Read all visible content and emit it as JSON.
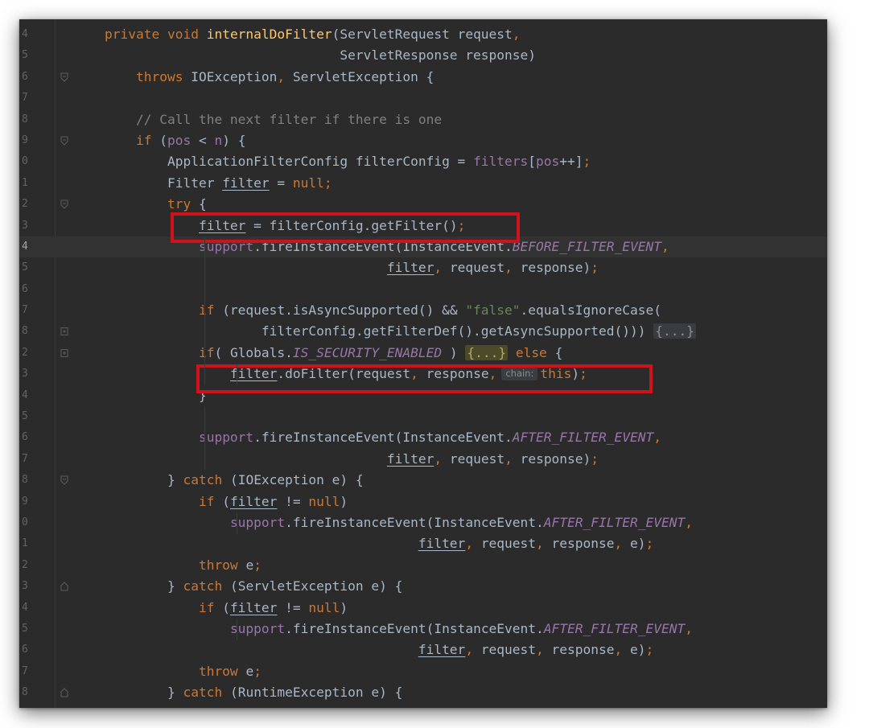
{
  "highlight_color": "#d0131b",
  "editor_theme": "darcula",
  "lines": [
    {
      "ln": "4",
      "indent": 0,
      "fold": "",
      "tokens": [
        {
          "t": "private void ",
          "c": "kw"
        },
        {
          "t": "internalDoFilter",
          "c": "fn"
        },
        {
          "t": "(ServletRequest request",
          "c": "p"
        },
        {
          "t": ",",
          "c": "kw"
        }
      ]
    },
    {
      "ln": "5",
      "indent": 0,
      "fold": "",
      "tokens": [
        {
          "t": "                              ServletResponse response)",
          "c": "p"
        }
      ]
    },
    {
      "ln": "6",
      "indent": 0,
      "fold": "open",
      "tokens": [
        {
          "t": "    throws ",
          "c": "kw"
        },
        {
          "t": "IOException",
          "c": "p"
        },
        {
          "t": ", ",
          "c": "kw"
        },
        {
          "t": "ServletException {",
          "c": "p"
        }
      ]
    },
    {
      "ln": "7",
      "indent": 0,
      "fold": "",
      "tokens": []
    },
    {
      "ln": "8",
      "indent": 0,
      "fold": "",
      "tokens": [
        {
          "t": "    // Call the next filter if there is one",
          "c": "cm"
        }
      ]
    },
    {
      "ln": "9",
      "indent": 0,
      "fold": "open",
      "tokens": [
        {
          "t": "    if ",
          "c": "kw"
        },
        {
          "t": "(",
          "c": "p"
        },
        {
          "t": "pos",
          "c": "fld"
        },
        {
          "t": " < ",
          "c": "p"
        },
        {
          "t": "n",
          "c": "fld"
        },
        {
          "t": ") {",
          "c": "p"
        }
      ]
    },
    {
      "ln": "0",
      "indent": 0,
      "fold": "",
      "tokens": [
        {
          "t": "        ApplicationFilterConfig filterConfig = ",
          "c": "p"
        },
        {
          "t": "filters",
          "c": "fld"
        },
        {
          "t": "[",
          "c": "p"
        },
        {
          "t": "pos",
          "c": "fld"
        },
        {
          "t": "++]",
          "c": "p"
        },
        {
          "t": ";",
          "c": "kw"
        }
      ]
    },
    {
      "ln": "1",
      "indent": 0,
      "fold": "",
      "tokens": [
        {
          "t": "        Filter ",
          "c": "p"
        },
        {
          "t": "filter",
          "c": "ul"
        },
        {
          "t": " = ",
          "c": "p"
        },
        {
          "t": "null;",
          "c": "kw"
        }
      ]
    },
    {
      "ln": "2",
      "indent": 0,
      "fold": "open",
      "tokens": [
        {
          "t": "        try ",
          "c": "kw"
        },
        {
          "t": "{",
          "c": "p"
        }
      ]
    },
    {
      "ln": "3",
      "indent": 0,
      "fold": "",
      "tokens": [
        {
          "t": "            ",
          "c": "p"
        },
        {
          "t": "filter",
          "c": "ul"
        },
        {
          "t": " = filterConfig.getFilter()",
          "c": "p"
        },
        {
          "t": ";",
          "c": "kw"
        }
      ]
    },
    {
      "ln": "4",
      "indent": 0,
      "fold": "",
      "current": true,
      "tokens": [
        {
          "t": "            ",
          "c": "p"
        },
        {
          "t": "support",
          "c": "fld"
        },
        {
          "t": ".fireInstanceEvent(InstanceEvent.",
          "c": "p"
        },
        {
          "t": "BEFORE_FILTER_EVENT",
          "c": "sf"
        },
        {
          "t": ",",
          "c": "kw"
        }
      ]
    },
    {
      "ln": "5",
      "indent": 0,
      "fold": "",
      "tokens": [
        {
          "t": "                                    ",
          "c": "p"
        },
        {
          "t": "filter",
          "c": "ul"
        },
        {
          "t": ", ",
          "c": "kw"
        },
        {
          "t": "request",
          "c": "p"
        },
        {
          "t": ", ",
          "c": "kw"
        },
        {
          "t": "response)",
          "c": "p"
        },
        {
          "t": ";",
          "c": "kw"
        }
      ]
    },
    {
      "ln": "6",
      "indent": 0,
      "fold": "",
      "tokens": []
    },
    {
      "ln": "7",
      "indent": 0,
      "fold": "",
      "tokens": [
        {
          "t": "            if ",
          "c": "kw"
        },
        {
          "t": "(request.isAsyncSupported() && ",
          "c": "p"
        },
        {
          "t": "\"false\"",
          "c": "str"
        },
        {
          "t": ".equalsIgnoreCase(",
          "c": "p"
        }
      ]
    },
    {
      "ln": "8",
      "indent": 0,
      "fold": "plus",
      "tokens": [
        {
          "t": "                    filterConfig.getFilterDef().getAsyncSupported())) ",
          "c": "p"
        },
        {
          "t": "{...}",
          "c": "ph"
        }
      ]
    },
    {
      "ln": "2",
      "indent": 0,
      "fold": "plus",
      "tokens": [
        {
          "t": "            if",
          "c": "kw"
        },
        {
          "t": "( Globals.",
          "c": "p"
        },
        {
          "t": "IS_SECURITY_ENABLED",
          "c": "sf"
        },
        {
          "t": " ) ",
          "c": "p"
        },
        {
          "t": "{...}",
          "c": "phh"
        },
        {
          "t": " else ",
          "c": "kw"
        },
        {
          "t": "{",
          "c": "p"
        }
      ]
    },
    {
      "ln": "3",
      "indent": 0,
      "fold": "",
      "tokens": [
        {
          "t": "                ",
          "c": "p"
        },
        {
          "t": "filter",
          "c": "ul"
        },
        {
          "t": ".doFilter(request",
          "c": "p"
        },
        {
          "t": ", ",
          "c": "kw"
        },
        {
          "t": "response",
          "c": "p"
        },
        {
          "t": ",",
          "c": "kw"
        },
        {
          "t": "chain:",
          "c": "hint"
        },
        {
          "t": "this",
          "c": "kw"
        },
        {
          "t": ")",
          "c": "p"
        },
        {
          "t": ";",
          "c": "kw"
        }
      ]
    },
    {
      "ln": "4",
      "indent": 0,
      "fold": "",
      "tokens": [
        {
          "t": "            }",
          "c": "p"
        }
      ]
    },
    {
      "ln": "5",
      "indent": 0,
      "fold": "",
      "tokens": []
    },
    {
      "ln": "6",
      "indent": 0,
      "fold": "",
      "tokens": [
        {
          "t": "            ",
          "c": "p"
        },
        {
          "t": "support",
          "c": "fld"
        },
        {
          "t": ".fireInstanceEvent(InstanceEvent.",
          "c": "p"
        },
        {
          "t": "AFTER_FILTER_EVENT",
          "c": "sf"
        },
        {
          "t": ",",
          "c": "kw"
        }
      ]
    },
    {
      "ln": "7",
      "indent": 0,
      "fold": "",
      "tokens": [
        {
          "t": "                                    ",
          "c": "p"
        },
        {
          "t": "filter",
          "c": "ul"
        },
        {
          "t": ", ",
          "c": "kw"
        },
        {
          "t": "request",
          "c": "p"
        },
        {
          "t": ", ",
          "c": "kw"
        },
        {
          "t": "response)",
          "c": "p"
        },
        {
          "t": ";",
          "c": "kw"
        }
      ]
    },
    {
      "ln": "8",
      "indent": 0,
      "fold": "open",
      "tokens": [
        {
          "t": "        } ",
          "c": "p"
        },
        {
          "t": "catch ",
          "c": "kw"
        },
        {
          "t": "(IOException e) {",
          "c": "p"
        }
      ]
    },
    {
      "ln": "9",
      "indent": 0,
      "fold": "",
      "tokens": [
        {
          "t": "            if ",
          "c": "kw"
        },
        {
          "t": "(",
          "c": "p"
        },
        {
          "t": "filter",
          "c": "ul"
        },
        {
          "t": " != ",
          "c": "p"
        },
        {
          "t": "null",
          "c": "kw"
        },
        {
          "t": ")",
          "c": "p"
        }
      ]
    },
    {
      "ln": "0",
      "indent": 0,
      "fold": "",
      "tokens": [
        {
          "t": "                ",
          "c": "p"
        },
        {
          "t": "support",
          "c": "fld"
        },
        {
          "t": ".fireInstanceEvent(InstanceEvent.",
          "c": "p"
        },
        {
          "t": "AFTER_FILTER_EVENT",
          "c": "sf"
        },
        {
          "t": ",",
          "c": "kw"
        }
      ]
    },
    {
      "ln": "1",
      "indent": 0,
      "fold": "",
      "tokens": [
        {
          "t": "                                        ",
          "c": "p"
        },
        {
          "t": "filter",
          "c": "ul"
        },
        {
          "t": ", ",
          "c": "kw"
        },
        {
          "t": "request",
          "c": "p"
        },
        {
          "t": ", ",
          "c": "kw"
        },
        {
          "t": "response",
          "c": "p"
        },
        {
          "t": ", ",
          "c": "kw"
        },
        {
          "t": "e)",
          "c": "p"
        },
        {
          "t": ";",
          "c": "kw"
        }
      ]
    },
    {
      "ln": "2",
      "indent": 0,
      "fold": "",
      "tokens": [
        {
          "t": "            throw ",
          "c": "kw"
        },
        {
          "t": "e",
          "c": "p"
        },
        {
          "t": ";",
          "c": "kw"
        }
      ]
    },
    {
      "ln": "3",
      "indent": 0,
      "fold": "close",
      "tokens": [
        {
          "t": "        } ",
          "c": "p"
        },
        {
          "t": "catch ",
          "c": "kw"
        },
        {
          "t": "(ServletException e) {",
          "c": "p"
        }
      ]
    },
    {
      "ln": "4",
      "indent": 0,
      "fold": "",
      "tokens": [
        {
          "t": "            if ",
          "c": "kw"
        },
        {
          "t": "(",
          "c": "p"
        },
        {
          "t": "filter",
          "c": "ul"
        },
        {
          "t": " != ",
          "c": "p"
        },
        {
          "t": "null",
          "c": "kw"
        },
        {
          "t": ")",
          "c": "p"
        }
      ]
    },
    {
      "ln": "5",
      "indent": 0,
      "fold": "",
      "tokens": [
        {
          "t": "                ",
          "c": "p"
        },
        {
          "t": "support",
          "c": "fld"
        },
        {
          "t": ".fireInstanceEvent(InstanceEvent.",
          "c": "p"
        },
        {
          "t": "AFTER_FILTER_EVENT",
          "c": "sf"
        },
        {
          "t": ",",
          "c": "kw"
        }
      ]
    },
    {
      "ln": "6",
      "indent": 0,
      "fold": "",
      "tokens": [
        {
          "t": "                                        ",
          "c": "p"
        },
        {
          "t": "filter",
          "c": "ul"
        },
        {
          "t": ", ",
          "c": "kw"
        },
        {
          "t": "request",
          "c": "p"
        },
        {
          "t": ", ",
          "c": "kw"
        },
        {
          "t": "response",
          "c": "p"
        },
        {
          "t": ", ",
          "c": "kw"
        },
        {
          "t": "e)",
          "c": "p"
        },
        {
          "t": ";",
          "c": "kw"
        }
      ]
    },
    {
      "ln": "7",
      "indent": 0,
      "fold": "",
      "tokens": [
        {
          "t": "            throw ",
          "c": "kw"
        },
        {
          "t": "e",
          "c": "p"
        },
        {
          "t": ";",
          "c": "kw"
        }
      ]
    },
    {
      "ln": "8",
      "indent": 0,
      "fold": "close",
      "tokens": [
        {
          "t": "        } ",
          "c": "p"
        },
        {
          "t": "catch ",
          "c": "kw"
        },
        {
          "t": "(RuntimeException e) {",
          "c": "p"
        }
      ]
    }
  ]
}
